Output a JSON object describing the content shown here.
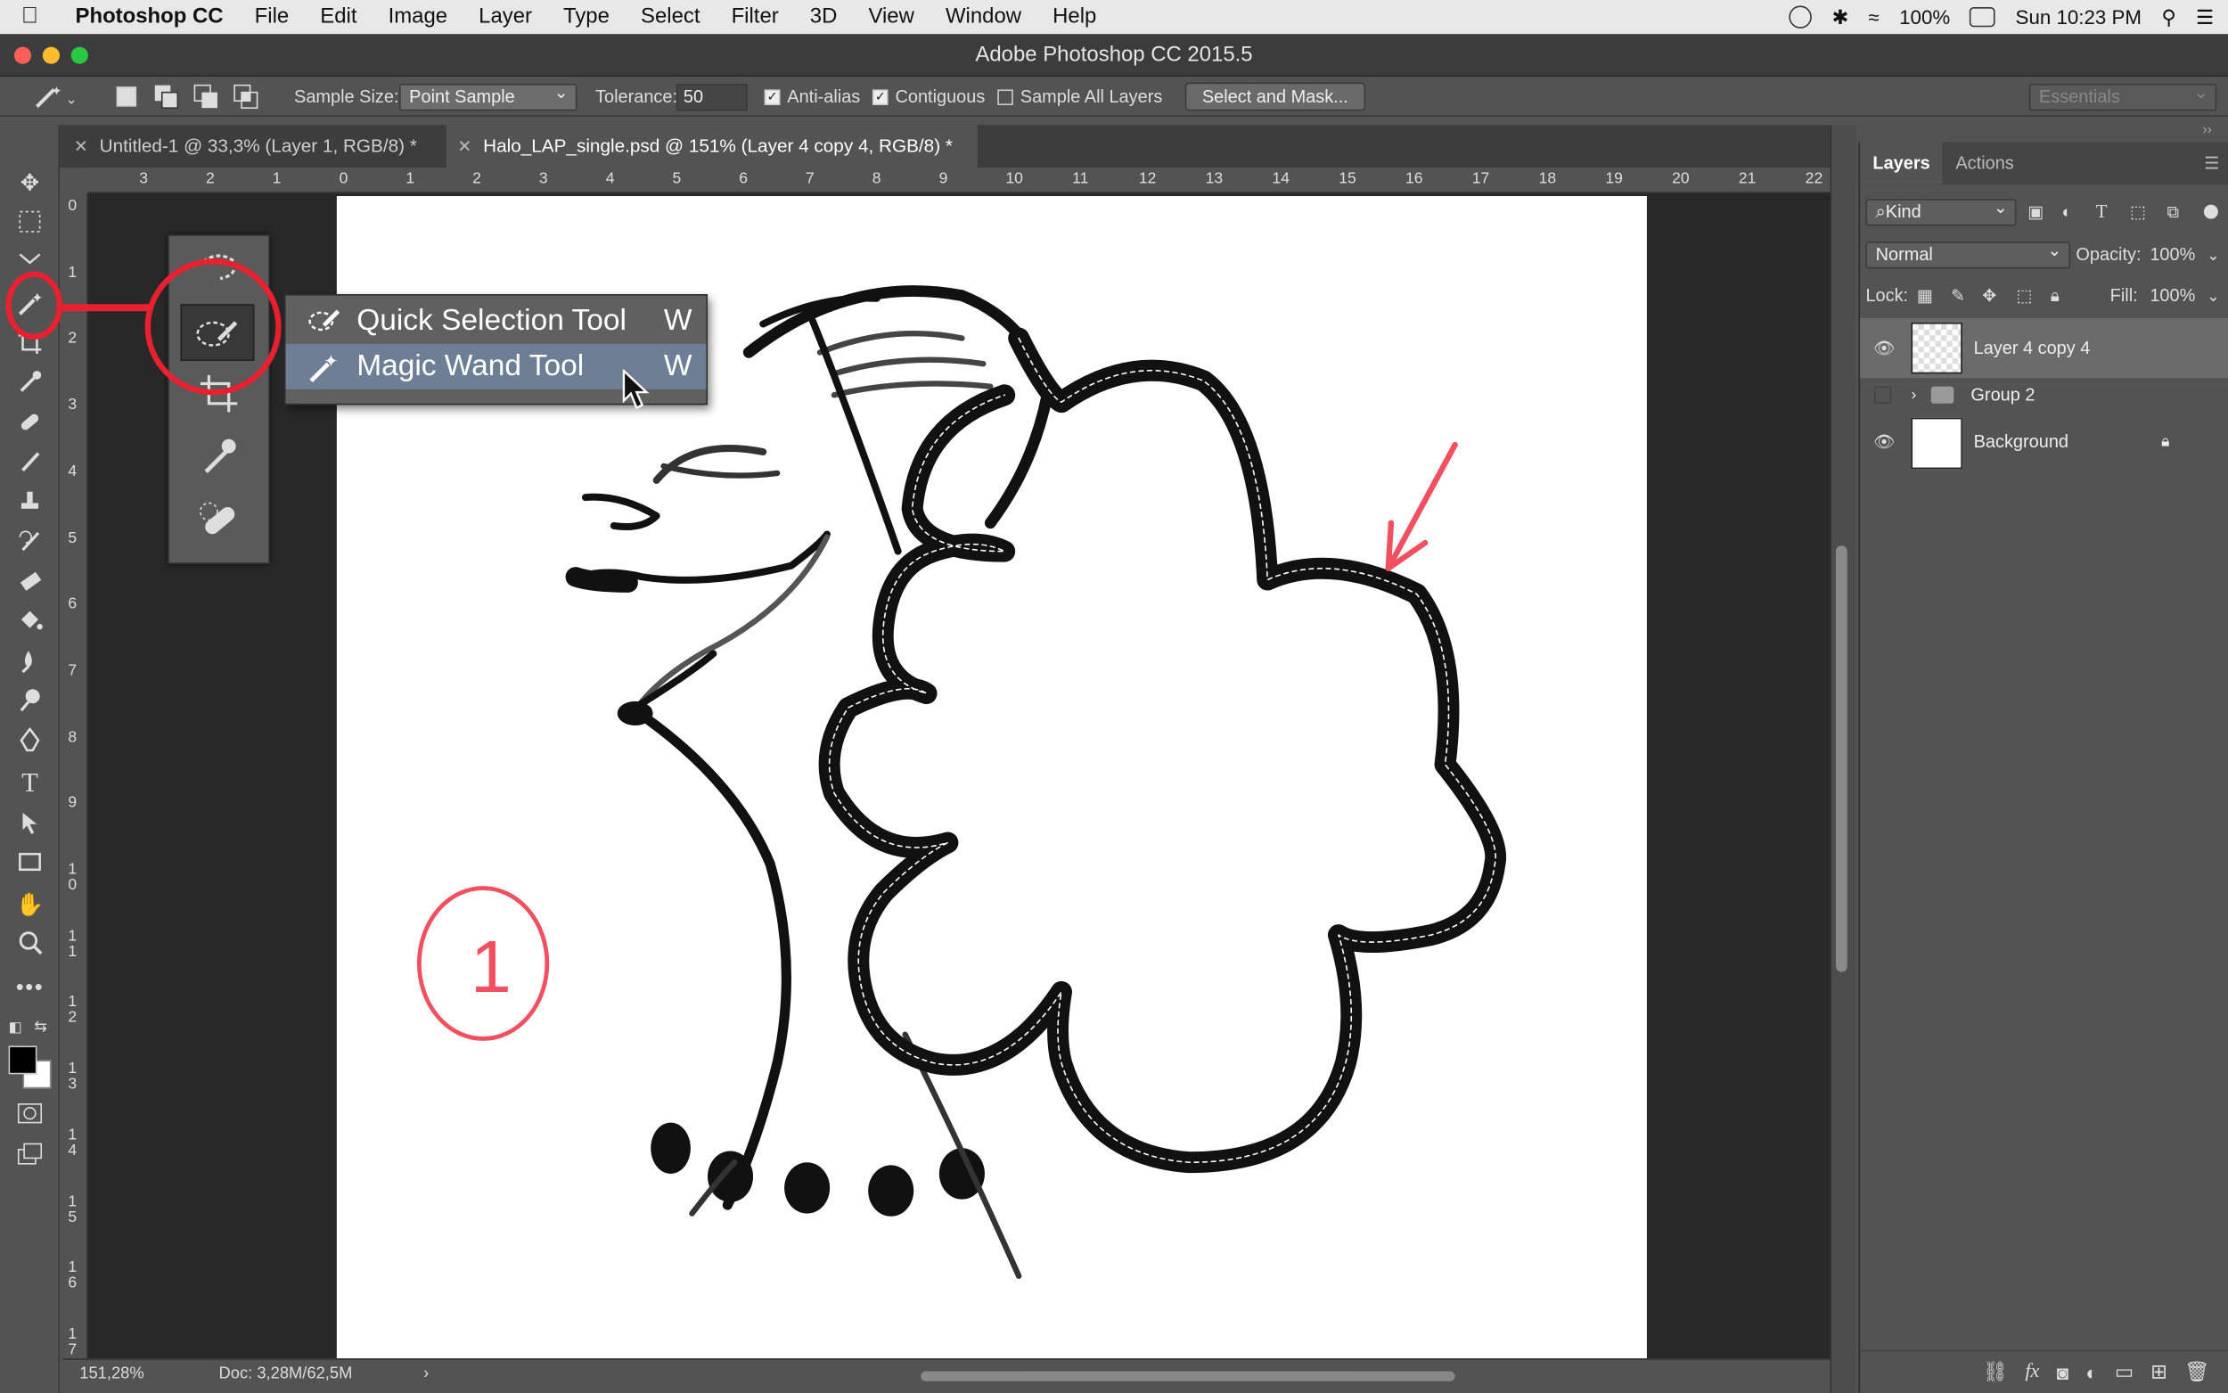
{
  "menubar": {
    "app_name": "Photoshop CC",
    "items": [
      "File",
      "Edit",
      "Image",
      "Layer",
      "Type",
      "Select",
      "Filter",
      "3D",
      "View",
      "Window",
      "Help"
    ],
    "battery": "100%",
    "clock": "Sun 10:23 PM"
  },
  "window": {
    "title": "Adobe Photoshop CC 2015.5",
    "traffic_colors": [
      "#fe5f57",
      "#febc2e",
      "#28c840"
    ]
  },
  "options_bar": {
    "sample_size_label": "Sample Size:",
    "sample_size_value": "Point Sample",
    "tolerance_label": "Tolerance:",
    "tolerance_value": "50",
    "anti_alias_label": "Anti-alias",
    "contiguous_label": "Contiguous",
    "sample_all_layers_label": "Sample All Layers",
    "select_mask_label": "Select and Mask...",
    "workspace_value": "Essentials"
  },
  "tabs": [
    {
      "label": "Untitled-1 @ 33,3% (Layer 1, RGB/8) *",
      "active": false
    },
    {
      "label": "Halo_LAP_single.psd @ 151% (Layer 4 copy 4, RGB/8) *",
      "active": true
    }
  ],
  "ruler": {
    "horizontal": [
      "3",
      "2",
      "1",
      "0",
      "1",
      "2",
      "3",
      "4",
      "5",
      "6",
      "7",
      "8",
      "9",
      "10",
      "11",
      "12",
      "13",
      "14",
      "15",
      "16",
      "17",
      "18",
      "19",
      "20",
      "21",
      "22"
    ],
    "vertical": [
      "0",
      "1",
      "2",
      "3",
      "4",
      "5",
      "6",
      "7",
      "8",
      "9",
      "1\n0",
      "1\n1",
      "1\n2",
      "1\n3",
      "1\n4",
      "1\n5",
      "1\n6",
      "1\n7"
    ]
  },
  "tool_submenu": {
    "items": [
      {
        "label": "Quick Selection Tool",
        "shortcut": "W",
        "selected": false
      },
      {
        "label": "Magic Wand Tool",
        "shortcut": "W",
        "selected": true
      }
    ]
  },
  "annotation": {
    "number": "1",
    "color": "#f05060"
  },
  "layers_panel": {
    "tabs": [
      "Layers",
      "Actions"
    ],
    "filter_kind": "Kind",
    "blend_mode": "Normal",
    "opacity_label": "Opacity:",
    "opacity_value": "100%",
    "lock_label": "Lock:",
    "fill_label": "Fill:",
    "fill_value": "100%",
    "layers": [
      {
        "name": "Layer 4 copy 4",
        "visible": true,
        "selected": true
      },
      {
        "name": "Group 2",
        "visible": false,
        "selected": false
      },
      {
        "name": "Background",
        "visible": true,
        "selected": false
      }
    ]
  },
  "status": {
    "zoom": "151,28%",
    "doc": "Doc: 3,28M/62,5M"
  }
}
